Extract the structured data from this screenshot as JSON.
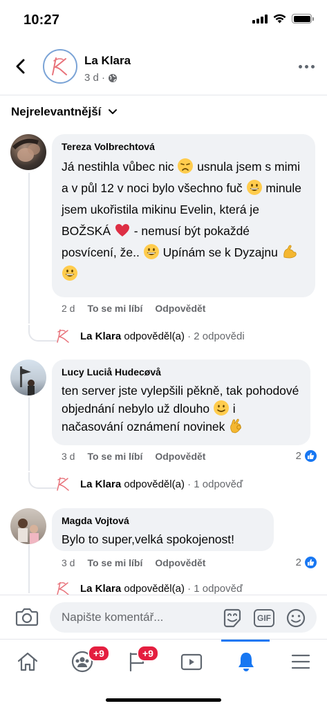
{
  "status_bar": {
    "time": "10:27"
  },
  "post_header": {
    "page_name": "La Klara",
    "meta": "3 d ·"
  },
  "sort": {
    "label": "Nejrelevantnější"
  },
  "comments": [
    {
      "author": "Tereza Volbrechtová",
      "text_parts": [
        "Já nestihla vůbec nic ",
        " usnula jsem s mimi a v půl 12 v noci bylo všechno fuč ",
        " minule jsem ukořistila mikinu Evelin, která je BOŽSKÁ ",
        " - nemusí být pokaždé posvícení, že.. ",
        " Upínám se k Dyzajnu "
      ],
      "time": "2 d",
      "like_label": "To se mi líbí",
      "reply_label": "Odpovědět",
      "reply": {
        "name": "La Klara",
        "text": "odpověděl(a)",
        "count": "· 2 odpovědi"
      }
    },
    {
      "author": "Lucy Luciå Hudecøvå",
      "text_parts": [
        "ten server jste vylepšili pěkně, tak pohodové objednání nebylo už dlouho ",
        " i načasování oznámení novinek "
      ],
      "time": "3 d",
      "like_label": "To se mi líbí",
      "reply_label": "Odpovědět",
      "likes": "2",
      "reply": {
        "name": "La Klara",
        "text": "odpověděl(a)",
        "count": "· 1 odpověď"
      }
    },
    {
      "author": "Magda Vojtová",
      "text": "Bylo to super,velká spokojenost!",
      "time": "3 d",
      "like_label": "To se mi líbí",
      "reply_label": "Odpovědět",
      "likes": "2",
      "reply": {
        "name": "La Klara",
        "text": "odpověděl(a)",
        "count": "· 1 odpověď"
      }
    }
  ],
  "composer": {
    "placeholder": "Napište komentář...",
    "gif_label": "GIF"
  },
  "tab_bar": {
    "tabs": [
      {
        "name": "home"
      },
      {
        "name": "groups",
        "badge": "+9"
      },
      {
        "name": "pages",
        "badge": "+9"
      },
      {
        "name": "watch"
      },
      {
        "name": "notifications",
        "active": true
      },
      {
        "name": "menu"
      }
    ]
  },
  "colors": {
    "accent": "#1877f2",
    "badge": "#e41e3f",
    "bubble": "#f0f2f5",
    "secondary_text": "#65676b",
    "brand_script": "#e8727a"
  },
  "icons": [
    "back-arrow-icon",
    "globe-icon",
    "more-icon",
    "chevron-down-icon",
    "camera-icon",
    "sticker-icon",
    "gif-icon",
    "smiley-icon",
    "home-icon",
    "groups-icon",
    "flag-icon",
    "watch-icon",
    "bell-icon",
    "hamburger-icon",
    "like-thumb-icon"
  ]
}
